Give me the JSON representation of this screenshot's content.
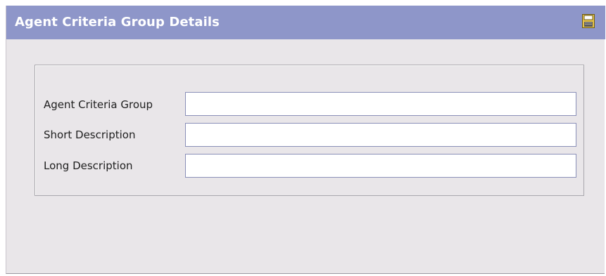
{
  "panel": {
    "title": "Agent Criteria Group Details",
    "save_icon": "save-icon"
  },
  "form": {
    "fields": [
      {
        "label": "Agent Criteria Group",
        "value": ""
      },
      {
        "label": "Short Description",
        "value": ""
      },
      {
        "label": "Long Description",
        "value": ""
      }
    ]
  },
  "colors": {
    "titlebar": "#8e96c9",
    "panel_bg": "#e9e6e9",
    "input_border": "#8a8fb8"
  }
}
